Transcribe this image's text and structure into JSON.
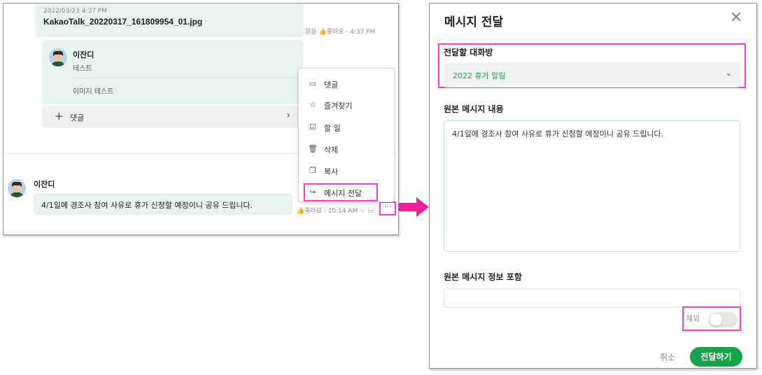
{
  "chat": {
    "file_message": {
      "date": "2022/03/23 4:37 PM",
      "file_name": "KakaoTalk_20220317_161809954_01.jpg",
      "read_label": "읽음",
      "like_label": "좋아요",
      "time": "4:37 PM"
    },
    "reply_card": {
      "sender": "이잔디",
      "text": "테스트",
      "image_text": "이미지 테스트"
    },
    "comment_bar": {
      "label": "댓글"
    },
    "message": {
      "sender": "이잔디",
      "text": "4/1일에 경조사 참여 사유로 휴가 신청할 예정이니 공유 드립니다.",
      "like_label": "좋아요",
      "time": "10:14 AM",
      "more_label": "···"
    }
  },
  "context_menu": {
    "items": [
      {
        "label": "댓글",
        "icon": "comment-icon"
      },
      {
        "label": "즐겨찾기",
        "icon": "star-icon"
      },
      {
        "label": "할 일",
        "icon": "todo-icon"
      },
      {
        "label": "삭제",
        "icon": "trash-icon"
      },
      {
        "label": "복사",
        "icon": "copy-icon"
      },
      {
        "label": "메시지 전달",
        "icon": "forward-icon"
      }
    ]
  },
  "dialog": {
    "title": "메시지 전달",
    "room_label": "전달할 대화방",
    "room_value": "2022 휴가 알림",
    "original_label": "원본 메시지 내용",
    "original_text": "4/1일에 경조사 참여 사유로 휴가 신청할 예정이니 공유 드립니다.",
    "info_label": "원본 메시지 정보 포함",
    "toggle_label": "제외",
    "toggle_on": false,
    "cancel_label": "취소",
    "send_label": "전달하기"
  },
  "colors": {
    "accent_green": "#16a34a",
    "highlight_magenta": "#ff3bd0",
    "arrow_pink": "#ee1f9a",
    "bubble_green": "#e9f3ee"
  }
}
